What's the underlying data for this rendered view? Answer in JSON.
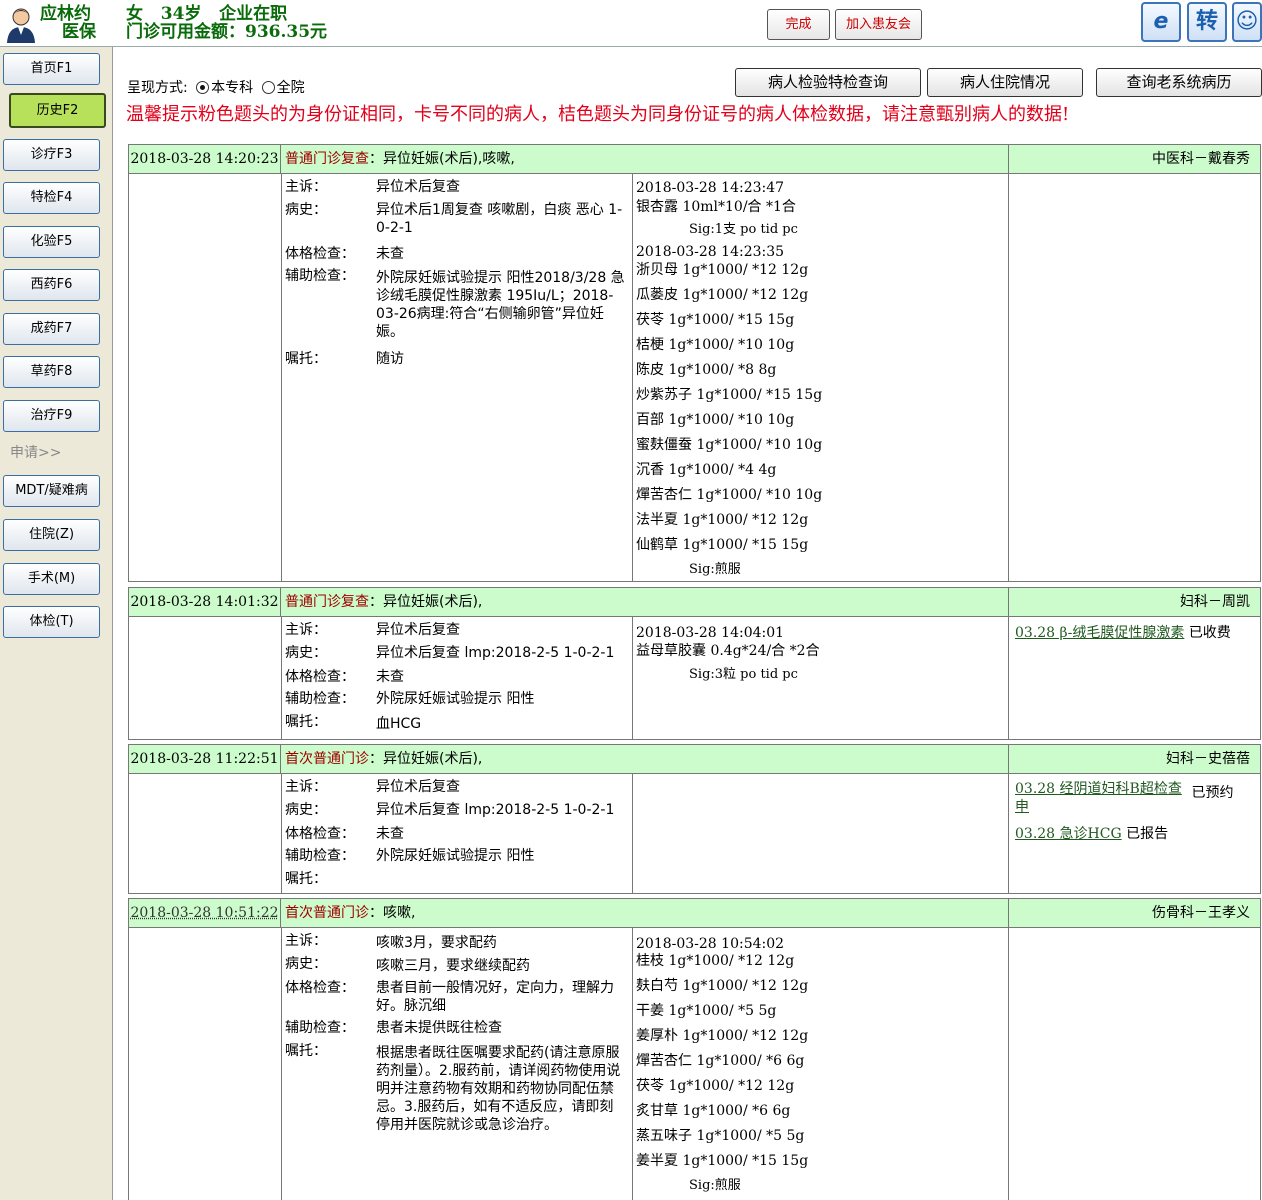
{
  "patient": {
    "name": "应林约",
    "insurance": "医保",
    "info": "女   34岁   企业在职",
    "balance": "门诊可用金额：936.35元"
  },
  "header_buttons": {
    "done": "完成",
    "join": "加入患友会",
    "transfer_icon": "转"
  },
  "sidebar": {
    "items": [
      "首页F1",
      "历史F2",
      "诊疗F3",
      "特检F4",
      "化验F5",
      "西药F6",
      "成药F7",
      "草药F8",
      "治疗F9"
    ],
    "apply_label": "申请>>",
    "apply_items": [
      "MDT/疑难病",
      "住院(Z)",
      "手术(M)",
      "体检(T)"
    ]
  },
  "toolbar": {
    "mode_label": "呈现方式:",
    "mode_options": [
      "本专科",
      "全院"
    ],
    "selected_mode": "本专科",
    "btn_exam": "病人检验特检查询",
    "btn_inpatient": "病人住院情况",
    "btn_old_records": "查询老系统病历",
    "warning": "温馨提示粉色题头的为身份证相同，卡号不同的病人，桔色题头为同身份证号的病人体检数据，请注意甄别病人的数据!"
  },
  "field_labels": [
    "主诉：",
    "病史：",
    "体格检查：",
    "辅助检查：",
    "嘱托："
  ],
  "records": [
    {
      "time": "2018-03-28 14:20:23",
      "visit_type": "普通门诊复查",
      "diagnosis": "：异位妊娠(术后),咳嗽,",
      "dept_doctor": "中医科－戴春秀",
      "fields": {
        "complaint": "异位术后复查",
        "history": "异位术后1周复查 咳嗽剧，白痰 恶心 1-0-2-1",
        "physical": "未查",
        "auxiliary": "外院尿妊娠试验提示 阳性2018/3/28 急诊绒毛膜促性腺激素 195Iu/L；2018-03-26病理:符合“右侧输卵管”异位妊娠。",
        "advice": "随访"
      },
      "rx": [
        {
          "time": "2018-03-28 14:23:47",
          "items": [
            "银杏露  10ml*10/合  *1合"
          ],
          "sig": "Sig:1支  po tid pc"
        },
        {
          "time": "2018-03-28 14:23:35",
          "items": [
            "浙贝母  1g*1000/  *12  12g",
            "瓜蒌皮  1g*1000/  *12  12g",
            "茯苓  1g*1000/  *15  15g",
            "桔梗  1g*1000/  *10  10g",
            "陈皮  1g*1000/  *8  8g",
            "炒紫苏子  1g*1000/  *15  15g",
            "百部  1g*1000/  *10  10g",
            "蜜麸僵蚕  1g*1000/  *10  10g",
            "沉香  1g*1000/  *4  4g",
            "燀苦杏仁  1g*1000/  *10  10g",
            "法半夏  1g*1000/  *12  12g",
            "仙鹤草  1g*1000/  *15  15g"
          ],
          "sig": "Sig:煎服"
        }
      ],
      "orders": []
    },
    {
      "time": "2018-03-28 14:01:32",
      "visit_type": "普通门诊复查",
      "diagnosis": "：异位妊娠(术后),",
      "dept_doctor": "妇科－周凯",
      "fields": {
        "complaint": "异位术后复查",
        "history": "异位术后复查 lmp:2018-2-5 1-0-2-1",
        "physical": "未查",
        "auxiliary": "外院尿妊娠试验提示 阳性",
        "advice": "血HCG"
      },
      "rx": [
        {
          "time": "2018-03-28 14:04:01",
          "items": [
            "益母草胶囊  0.4g*24/合  *2合"
          ],
          "sig": "Sig:3粒  po tid pc"
        }
      ],
      "orders": [
        {
          "link": "03.28 β-绒毛膜促性腺激素",
          "status": "已收费"
        }
      ]
    },
    {
      "time": "2018-03-28 11:22:51",
      "visit_type": "首次普通门诊",
      "diagnosis": "：异位妊娠(术后),",
      "dept_doctor": "妇科－史蓓蓓",
      "fields": {
        "complaint": "异位术后复查",
        "history": "异位术后复查 lmp:2018-2-5 1-0-2-1",
        "physical": "未查",
        "auxiliary": "外院尿妊娠试验提示 阳性",
        "advice": ""
      },
      "rx": [],
      "orders": [
        {
          "link": "03.28 经阴道妇科B超检查申",
          "status": "已预约"
        },
        {
          "link": "03.28 急诊HCG",
          "status": "已报告"
        }
      ]
    },
    {
      "time": "2018-03-28 10:51:22",
      "visit_type": "首次普通门诊",
      "diagnosis": "：咳嗽,",
      "dept_doctor": "伤骨科－王孝义",
      "fields": {
        "complaint": "咳嗽3月，要求配药",
        "history": "咳嗽三月，要求继续配药",
        "physical": "患者目前一般情况好，定向力，理解力好。脉沉细",
        "auxiliary": "患者未提供既往检查",
        "advice": "根据患者既往医嘱要求配药(请注意原服药剂量）。2.服药前，请详阅药物使用说明并注意药物有效期和药物协同配伍禁忌。3.服药后，如有不适反应，请即刻停用并医院就诊或急诊治疗。"
      },
      "rx": [
        {
          "time": "2018-03-28 10:54:02",
          "items": [
            "桂枝  1g*1000/  *12  12g",
            "麸白芍  1g*1000/  *12  12g",
            "干姜  1g*1000/  *5  5g",
            "姜厚朴  1g*1000/  *12  12g",
            "燀苦杏仁  1g*1000/  *6  6g",
            "茯苓  1g*1000/  *12  12g",
            "炙甘草  1g*1000/  *6  6g",
            "蒸五味子  1g*1000/  *5  5g",
            "姜半夏  1g*1000/  *15  15g"
          ],
          "sig": "Sig:煎服"
        }
      ],
      "orders": []
    }
  ]
}
